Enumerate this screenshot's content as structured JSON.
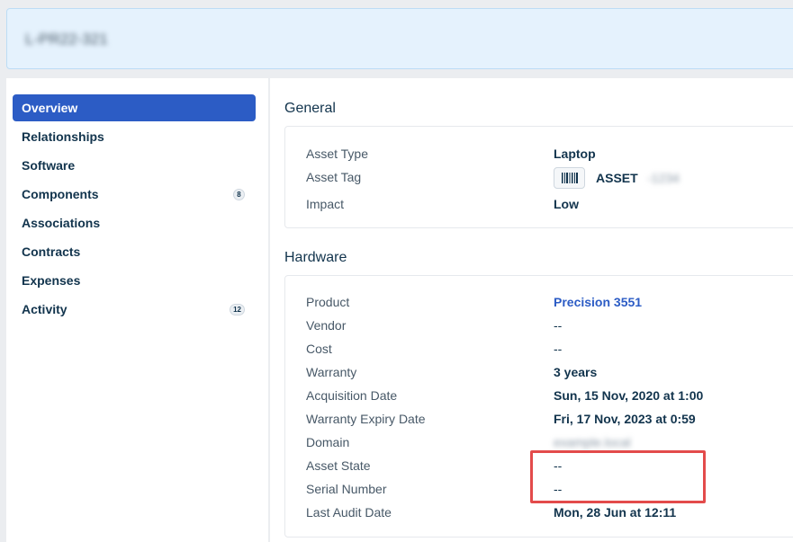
{
  "header": {
    "title": "L-PR22-321"
  },
  "sidebar": {
    "items": [
      {
        "label": "Overview",
        "active": true,
        "badge": ""
      },
      {
        "label": "Relationships",
        "active": false,
        "badge": ""
      },
      {
        "label": "Software",
        "active": false,
        "badge": ""
      },
      {
        "label": "Components",
        "active": false,
        "badge": "8"
      },
      {
        "label": "Associations",
        "active": false,
        "badge": ""
      },
      {
        "label": "Contracts",
        "active": false,
        "badge": ""
      },
      {
        "label": "Expenses",
        "active": false,
        "badge": ""
      },
      {
        "label": "Activity",
        "active": false,
        "badge": "12"
      }
    ]
  },
  "general": {
    "title": "General",
    "asset_type_label": "Asset Type",
    "asset_type_value": "Laptop",
    "asset_tag_label": "Asset Tag",
    "asset_tag_value": "ASSET",
    "asset_tag_blurred": "-1234",
    "impact_label": "Impact",
    "impact_value": "Low"
  },
  "hardware": {
    "title": "Hardware",
    "rows": [
      {
        "label": "Product",
        "value": "Precision 3551"
      },
      {
        "label": "Vendor",
        "value": "--"
      },
      {
        "label": "Cost",
        "value": "--"
      },
      {
        "label": "Warranty",
        "value": "3 years"
      },
      {
        "label": "Acquisition Date",
        "value": "Sun, 15 Nov, 2020 at 1:00"
      },
      {
        "label": "Warranty Expiry Date",
        "value": "Fri, 17 Nov, 2023 at 0:59"
      },
      {
        "label": "Domain",
        "value": "example.local"
      },
      {
        "label": "Asset State",
        "value": "--"
      },
      {
        "label": "Serial Number",
        "value": "--"
      },
      {
        "label": "Last Audit Date",
        "value": "Mon, 28 Jun at 12:11"
      }
    ]
  },
  "colors": {
    "accent": "#2c5cc5",
    "highlight": "#e34b4b",
    "banner": "#e5f2fd"
  }
}
